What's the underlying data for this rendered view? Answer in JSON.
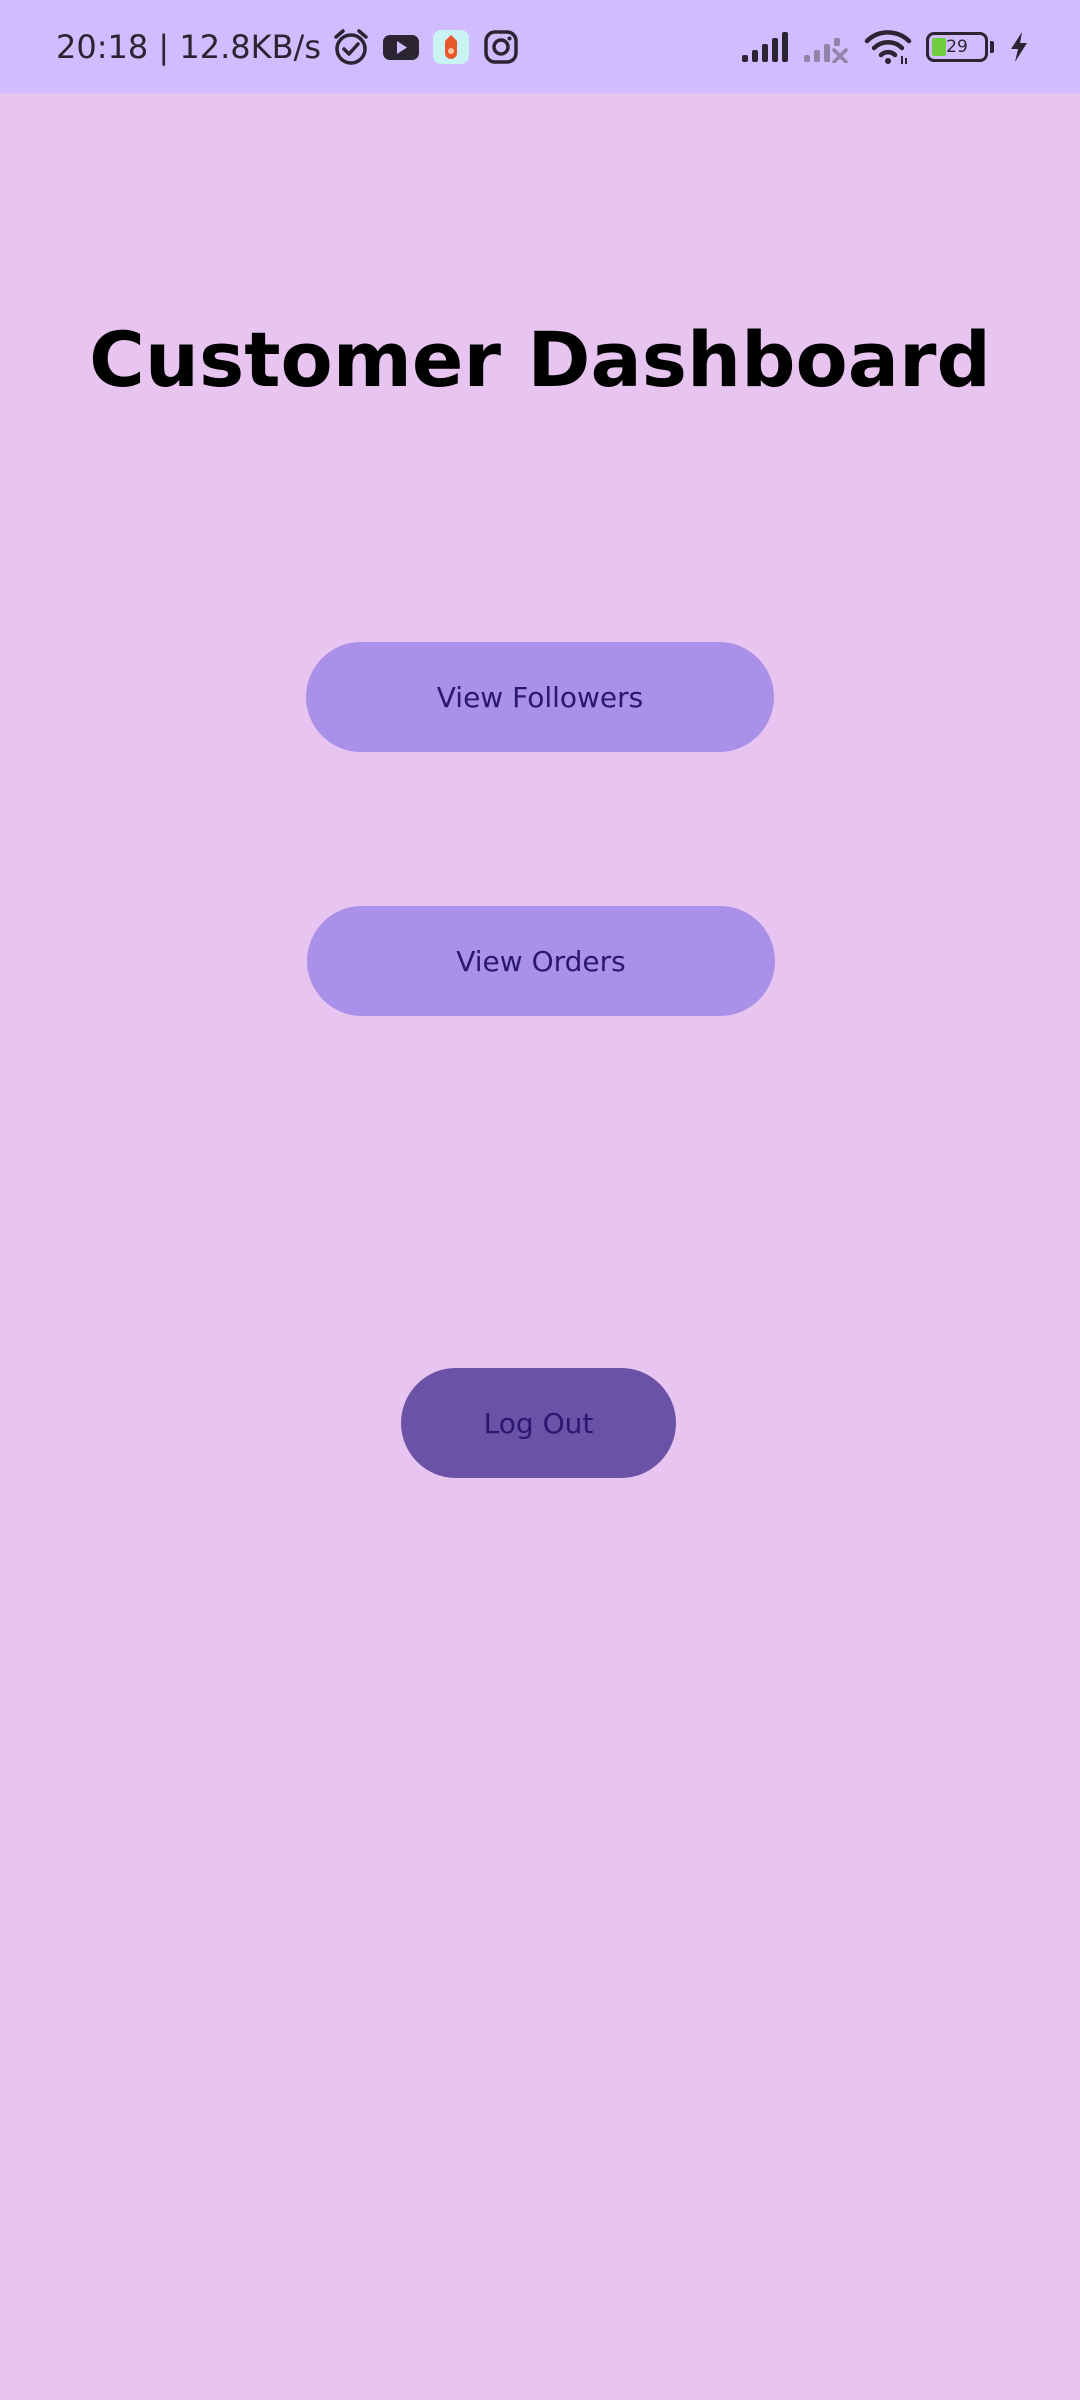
{
  "status_bar": {
    "time_speed": "20:18 | 12.8KB/s",
    "battery_level": "29",
    "icons": [
      "alarm-icon",
      "youtube-icon",
      "app-icon",
      "instagram-icon",
      "signal-icon",
      "signal-no-sim-icon",
      "wifi-icon",
      "battery-icon",
      "charging-icon"
    ]
  },
  "page": {
    "title": "Customer Dashboard"
  },
  "buttons": {
    "view_followers": "View Followers",
    "view_orders": "View Orders",
    "log_out": "Log Out"
  },
  "colors": {
    "background": "#e8c4f0",
    "status_bar": "#d0bcff",
    "primary_button": "#a990e8",
    "logout_button": "#6a52a6",
    "button_text": "#2a1870"
  }
}
